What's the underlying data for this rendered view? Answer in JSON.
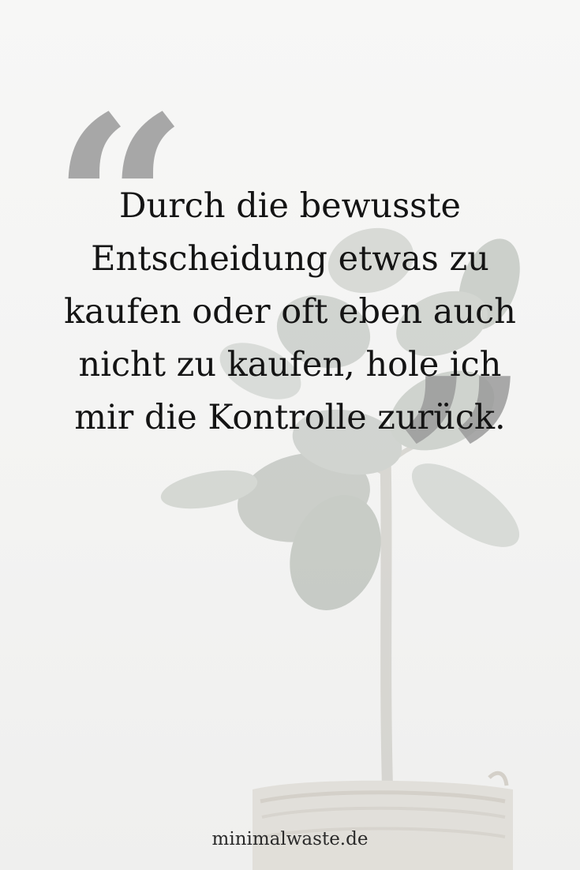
{
  "quote": {
    "text": "Durch die bewusste Entscheidung etwas zu kaufen oder oft eben auch nicht zu kaufen, hole ich mir die Kontrolle zurück.",
    "open_mark": "“",
    "close_mark": "”"
  },
  "footer": {
    "site": "minimalwaste.de"
  },
  "colors": {
    "background": "#f4f4f3",
    "text": "#141414",
    "quote_marks": "#9a9a9a",
    "leaves": "#c9cdc8"
  }
}
